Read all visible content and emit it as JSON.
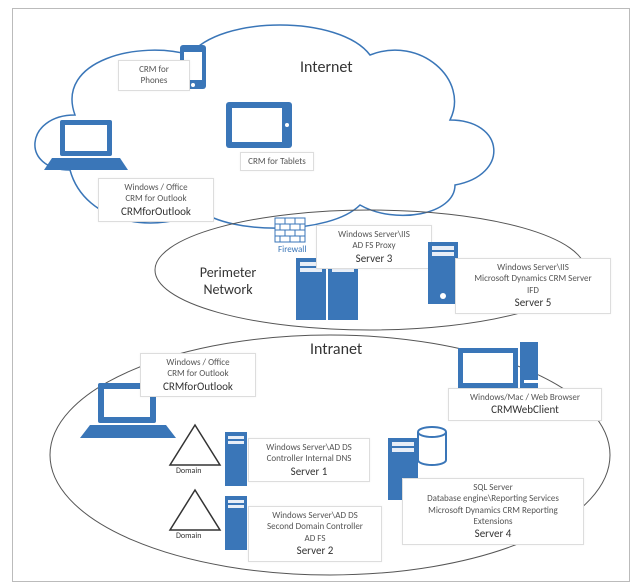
{
  "zones": {
    "internet": "Internet",
    "perimeter_line1": "Perimeter",
    "perimeter_line2": "Network",
    "intranet": "Intranet"
  },
  "firewall": {
    "label": "Firewall"
  },
  "internet_zone": {
    "phones": {
      "label": "CRM for Phones"
    },
    "tablets": {
      "label": "CRM for Tablets"
    },
    "laptop": {
      "line1": "Windows / Office",
      "line2": "CRM for Outlook",
      "title": "CRMforOutlook"
    }
  },
  "perimeter_zone": {
    "server3": {
      "line1": "Windows Server\\IIS",
      "line2": "AD FS Proxy",
      "title": "Server 3"
    },
    "server5": {
      "line1": "Windows Server\\IIS",
      "line2": "Microsoft Dynamics CRM Server",
      "line3": "IFD",
      "title": "Server 5"
    }
  },
  "intranet_zone": {
    "laptop": {
      "line1": "Windows / Office",
      "line2": "CRM for Outlook",
      "title": "CRMforOutlook"
    },
    "webclient": {
      "line1": "Windows/Mac  / Web Browser",
      "title": "CRMWebClient"
    },
    "domain1": {
      "tag": "Domain",
      "line1": "Windows Server\\AD DS",
      "line2": "Controller Internal DNS",
      "title": "Server  1"
    },
    "domain2": {
      "tag": "Domain",
      "line1": "Windows Server\\AD DS",
      "line2": "Second Domain Controller",
      "line3": "AD FS",
      "title": "Server  2"
    },
    "server4": {
      "line1": "SQL Server",
      "line2": "Database engine\\Reporting Services",
      "line3": "Microsoft Dynamics CRM Reporting",
      "line4": "Extensions",
      "title": "Server  4"
    }
  }
}
